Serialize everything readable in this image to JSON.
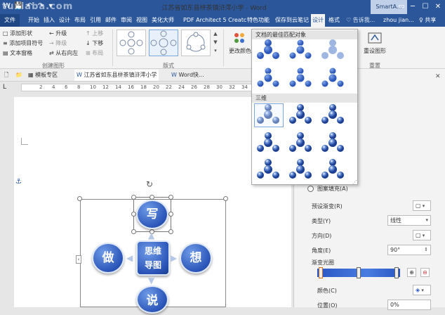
{
  "titlebar": {
    "title": "江苏省如东县栟茶镇浒澪小学 - Word",
    "context_tab": "SmartA...",
    "qat": [
      "💾",
      "↶",
      "↷",
      "▾"
    ],
    "window_buttons": [
      "▭",
      "─",
      "☐",
      "✕"
    ]
  },
  "tabs": [
    "文件",
    "开始",
    "插入",
    "设计",
    "布局",
    "引用",
    "邮件",
    "审阅",
    "视图",
    "美化大师",
    "PDF Architect 5 Creatc",
    "特色功能",
    "保存到云笔记",
    "设计",
    "格式"
  ],
  "tell_me": "♡ 告诉我...",
  "user": "zhou jian...",
  "share": "♀ 共享",
  "ribbon": {
    "create_graphic": {
      "add_shape": "添加形状",
      "add_bullet": "添加项目符号",
      "text_pane": "文本窗格",
      "promote": "升级",
      "demote": "降级",
      "right_to_left": "从右向左",
      "move_up": "上移",
      "move_down": "下移",
      "layout_btn": "布局",
      "group_label": "创建图形"
    },
    "layouts_label": "版式",
    "change_colors": "更改颜色",
    "reset_graphic": "重设图形",
    "reset_label": "重置"
  },
  "doc_tabs": [
    "模板专区",
    "江苏省如东县栟茶镇浒澪小学",
    "Word快..."
  ],
  "dropdown": {
    "section1": "文档的最佳匹配对象",
    "section2": "三维"
  },
  "ruler_ticks": [
    "2",
    "4",
    "6",
    "8",
    "10",
    "12",
    "14",
    "16",
    "18",
    "20",
    "22",
    "24",
    "26",
    "28",
    "30",
    "32",
    "34"
  ],
  "smartart": {
    "top": "写",
    "left": "做",
    "center": "思维\n导图",
    "right": "想",
    "bottom": "说"
  },
  "pane": {
    "picture_fill": "图案填充(A)",
    "preset_gradient": "预设渐变(R)",
    "type_label": "类型(Y)",
    "type_value": "线性",
    "direction": "方向(D)",
    "angle_label": "角度(E)",
    "angle_value": "90°",
    "gradient_stops": "渐变光圈",
    "color": "颜色(C)",
    "position_label": "位置(O)",
    "position_value": "0%"
  },
  "watermark": "tuxiaba.com",
  "colors": {
    "accent": "#2b579a",
    "node": "#2b55b8"
  }
}
